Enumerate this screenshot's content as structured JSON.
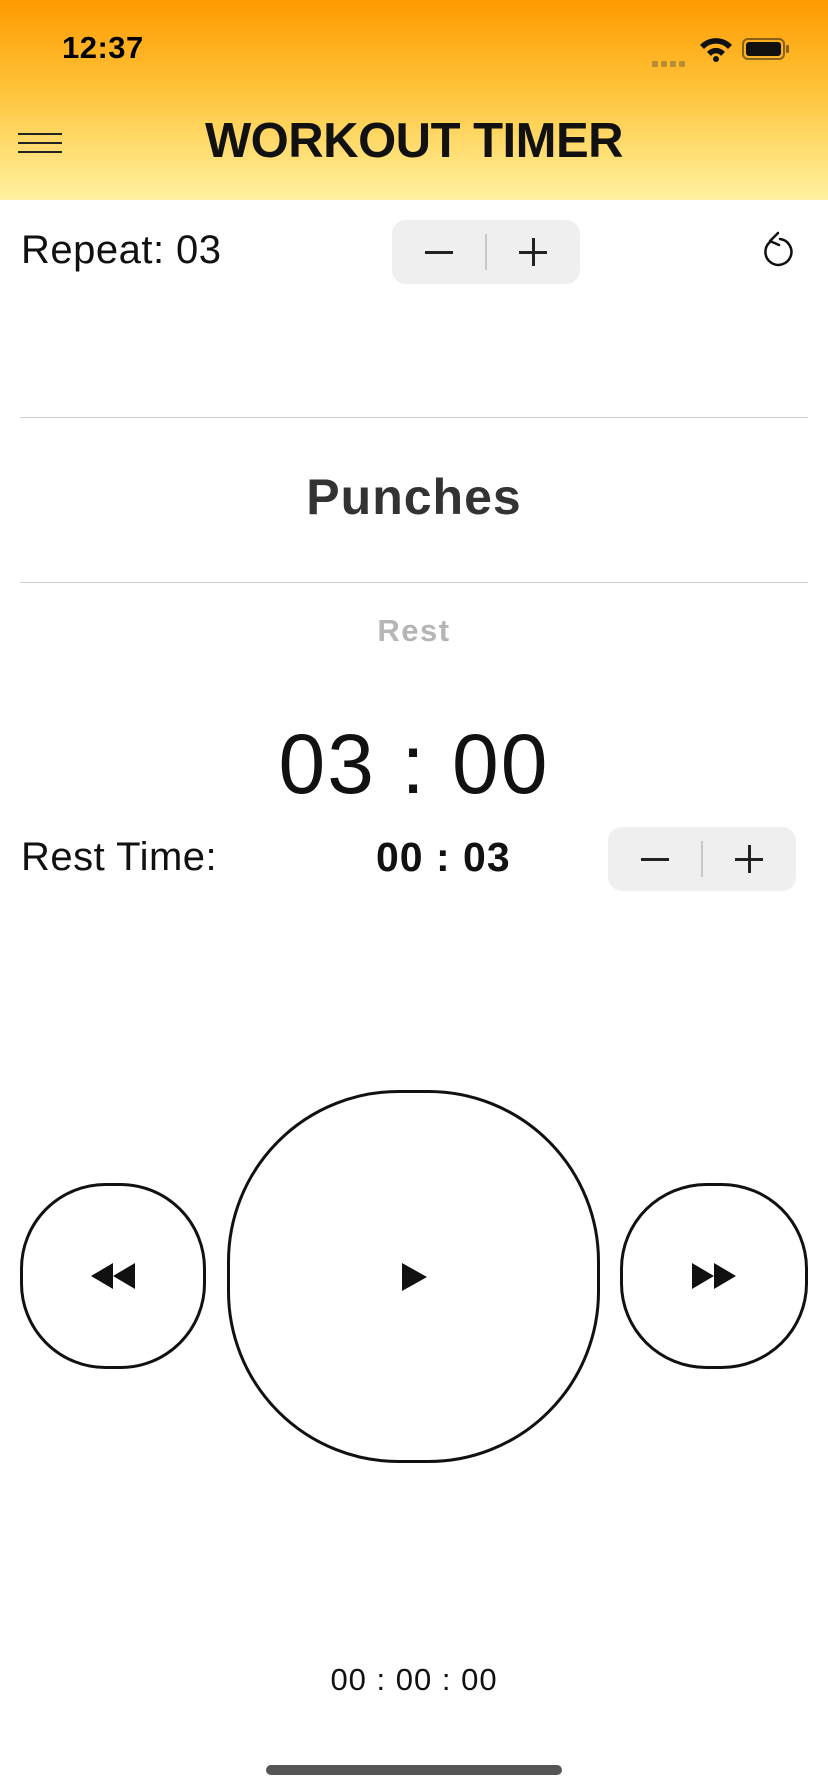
{
  "status_bar": {
    "time": "12:37"
  },
  "header": {
    "title": "WORKOUT TIMER",
    "menu_icon": "hamburger-icon"
  },
  "repeat": {
    "label": "Repeat:",
    "value": "03",
    "decrement_icon": "minus-icon",
    "increment_icon": "plus-icon",
    "reset_icon": "reset-icon"
  },
  "exercise": {
    "name": "Punches",
    "phase": "Rest",
    "timer": "03 : 00"
  },
  "rest_time": {
    "label": "Rest Time:",
    "value": "00 : 03"
  },
  "controls": {
    "rewind_icon": "rewind-icon",
    "play_icon": "play-icon",
    "forward_icon": "fast-forward-icon"
  },
  "total_elapsed": "00 : 00 : 00",
  "colors": {
    "header_top": "#ff9a00",
    "header_bottom": "#fff2a0",
    "stepper_bg": "#efefef",
    "phase_label": "#b5b5b5"
  }
}
